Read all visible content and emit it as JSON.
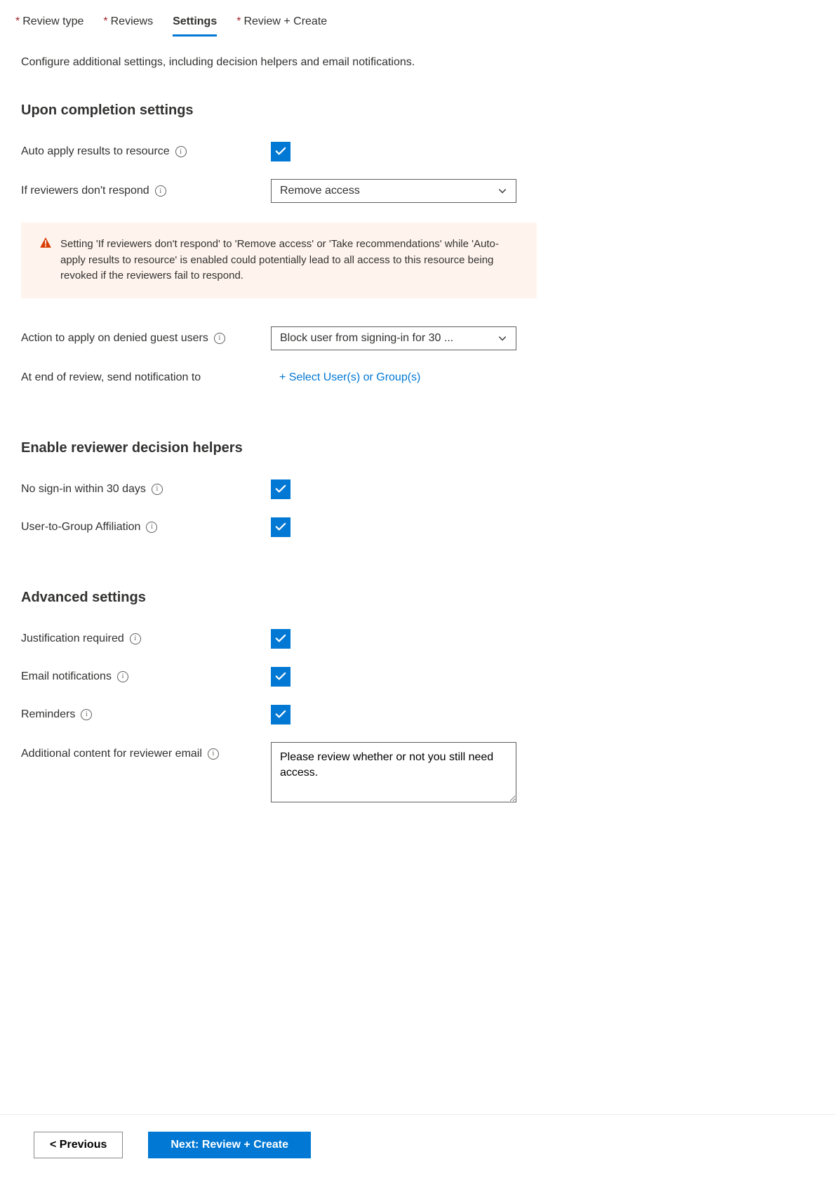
{
  "tabs": {
    "review_type": "Review type",
    "reviews": "Reviews",
    "settings": "Settings",
    "review_create": "Review + Create"
  },
  "description": "Configure additional settings, including decision helpers and email notifications.",
  "sections": {
    "upon_completion": {
      "heading": "Upon completion settings",
      "auto_apply_label": "Auto apply results to resource",
      "no_response_label": "If reviewers don't respond",
      "no_response_value": "Remove access",
      "warning_text": "Setting 'If reviewers don't respond' to 'Remove access' or 'Take recommendations' while 'Auto-apply results to resource' is enabled could potentially lead to all access to this resource being revoked if the reviewers fail to respond.",
      "denied_guest_label": "Action to apply on denied guest users",
      "denied_guest_value": "Block user from signing-in for 30 ...",
      "notification_label": "At end of review, send notification to",
      "notification_link": "+ Select User(s) or Group(s)"
    },
    "decision_helpers": {
      "heading": "Enable reviewer decision helpers",
      "no_signin_label": "No sign-in within 30 days",
      "affiliation_label": "User-to-Group Affiliation"
    },
    "advanced": {
      "heading": "Advanced settings",
      "justification_label": "Justification required",
      "email_label": "Email notifications",
      "reminders_label": "Reminders",
      "additional_content_label": "Additional content for reviewer email",
      "additional_content_value": "Please review whether or not you still need access."
    }
  },
  "footer": {
    "previous": "< Previous",
    "next": "Next: Review + Create"
  }
}
